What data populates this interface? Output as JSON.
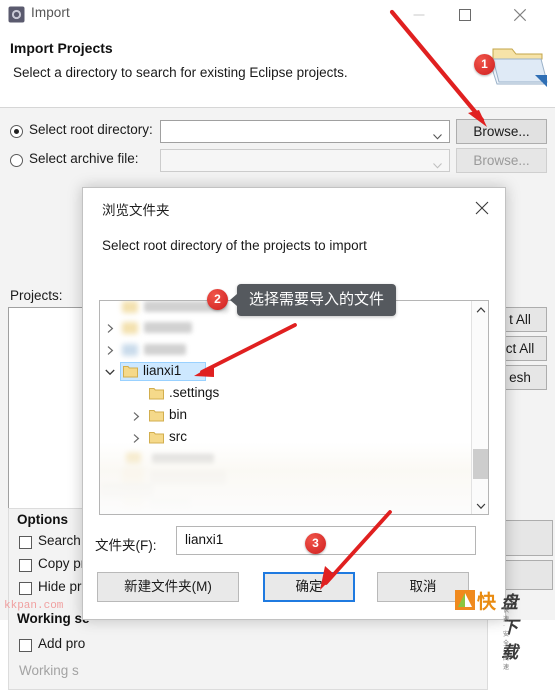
{
  "window": {
    "title": "Import",
    "icon": "eclipse-import-icon",
    "controls": {
      "minimize": "minimize-icon",
      "maximize": "maximize-icon",
      "close": "close-icon"
    }
  },
  "header": {
    "title": "Import Projects",
    "description": "Select a directory to search for existing Eclipse projects.",
    "banner_icon": "folder-wizard-icon"
  },
  "form": {
    "root_directory": {
      "label": "Select root directory:",
      "selected": true,
      "value": "",
      "placeholder": "",
      "browse_label": "Browse..."
    },
    "archive_file": {
      "label": "Select archive file:",
      "selected": false,
      "value": "",
      "placeholder": "",
      "browse_label": "Browse...",
      "disabled": true
    },
    "projects_label": "Projects:",
    "side_buttons": [
      {
        "label": "Select All",
        "visible_text": "t All"
      },
      {
        "label": "Deselect All",
        "visible_text": "ct All"
      },
      {
        "label": "Refresh",
        "visible_text": "esh"
      }
    ]
  },
  "options": {
    "group_title": "Options",
    "items": [
      {
        "label": "Search for nested projects",
        "visible_text": "Search f",
        "checked": false
      },
      {
        "label": "Copy projects into workspace",
        "visible_text": "Copy pr",
        "checked": false
      },
      {
        "label": "Hide projects that already exist in the workspace",
        "visible_text": "Hide pro",
        "checked": false
      }
    ],
    "working_sets_title": "Working sets",
    "working_sets_title_visible": "Working se",
    "add_to_working_sets": {
      "label": "Add project to working sets",
      "visible_text": "Add pro",
      "checked": false
    },
    "working_sets_field_label": "Working sets:",
    "working_sets_field_visible": "Working s",
    "disabled": true
  },
  "folder_dialog": {
    "title": "浏览文件夹",
    "close_icon": "close-icon",
    "prompt": "Select root directory of the projects to import",
    "tree": [
      {
        "name": "",
        "blurred": true,
        "indent": 0,
        "expander": "none",
        "selected": false
      },
      {
        "name": "",
        "blurred": true,
        "indent": 0,
        "expander": "collapsed",
        "selected": false
      },
      {
        "name": "",
        "blurred": true,
        "indent": 0,
        "expander": "collapsed",
        "selected": false
      },
      {
        "name": "lianxi1",
        "blurred": false,
        "indent": 0,
        "expander": "expanded",
        "selected": true
      },
      {
        "name": ".settings",
        "blurred": false,
        "indent": 1,
        "expander": "none",
        "selected": false
      },
      {
        "name": "bin",
        "blurred": false,
        "indent": 1,
        "expander": "collapsed",
        "selected": false
      },
      {
        "name": "src",
        "blurred": false,
        "indent": 1,
        "expander": "collapsed",
        "selected": false
      },
      {
        "name": "",
        "blurred": true,
        "indent": 1,
        "expander": "none",
        "selected": false
      }
    ],
    "scrollbar": {
      "up_icon": "chevron-up-icon",
      "down_icon": "chevron-down-icon"
    },
    "folder_field": {
      "label": "文件夹(F):",
      "value": "lianxi1"
    },
    "buttons": {
      "new_folder": "新建文件夹(M)",
      "ok": "确定",
      "cancel": "取消"
    }
  },
  "annotations": {
    "badges": [
      {
        "id": "1",
        "text": "1"
      },
      {
        "id": "2",
        "text": "2"
      },
      {
        "id": "3",
        "text": "3"
      }
    ],
    "tooltip": "选择需要导入的文件",
    "arrow_color": "#e02020"
  },
  "watermarks": {
    "bottom_left": "kkpan.com",
    "brand_kuai": "快",
    "brand_pan": "盘下载",
    "brand_sub": "快速 · 安全 · 高速"
  },
  "colors": {
    "accent_blue": "#1f7ae0",
    "selection_blue": "#cde8ff",
    "annotation_red": "#e02020",
    "badge_red": "#cf1f1f",
    "tooltip_gray": "#55595e"
  }
}
